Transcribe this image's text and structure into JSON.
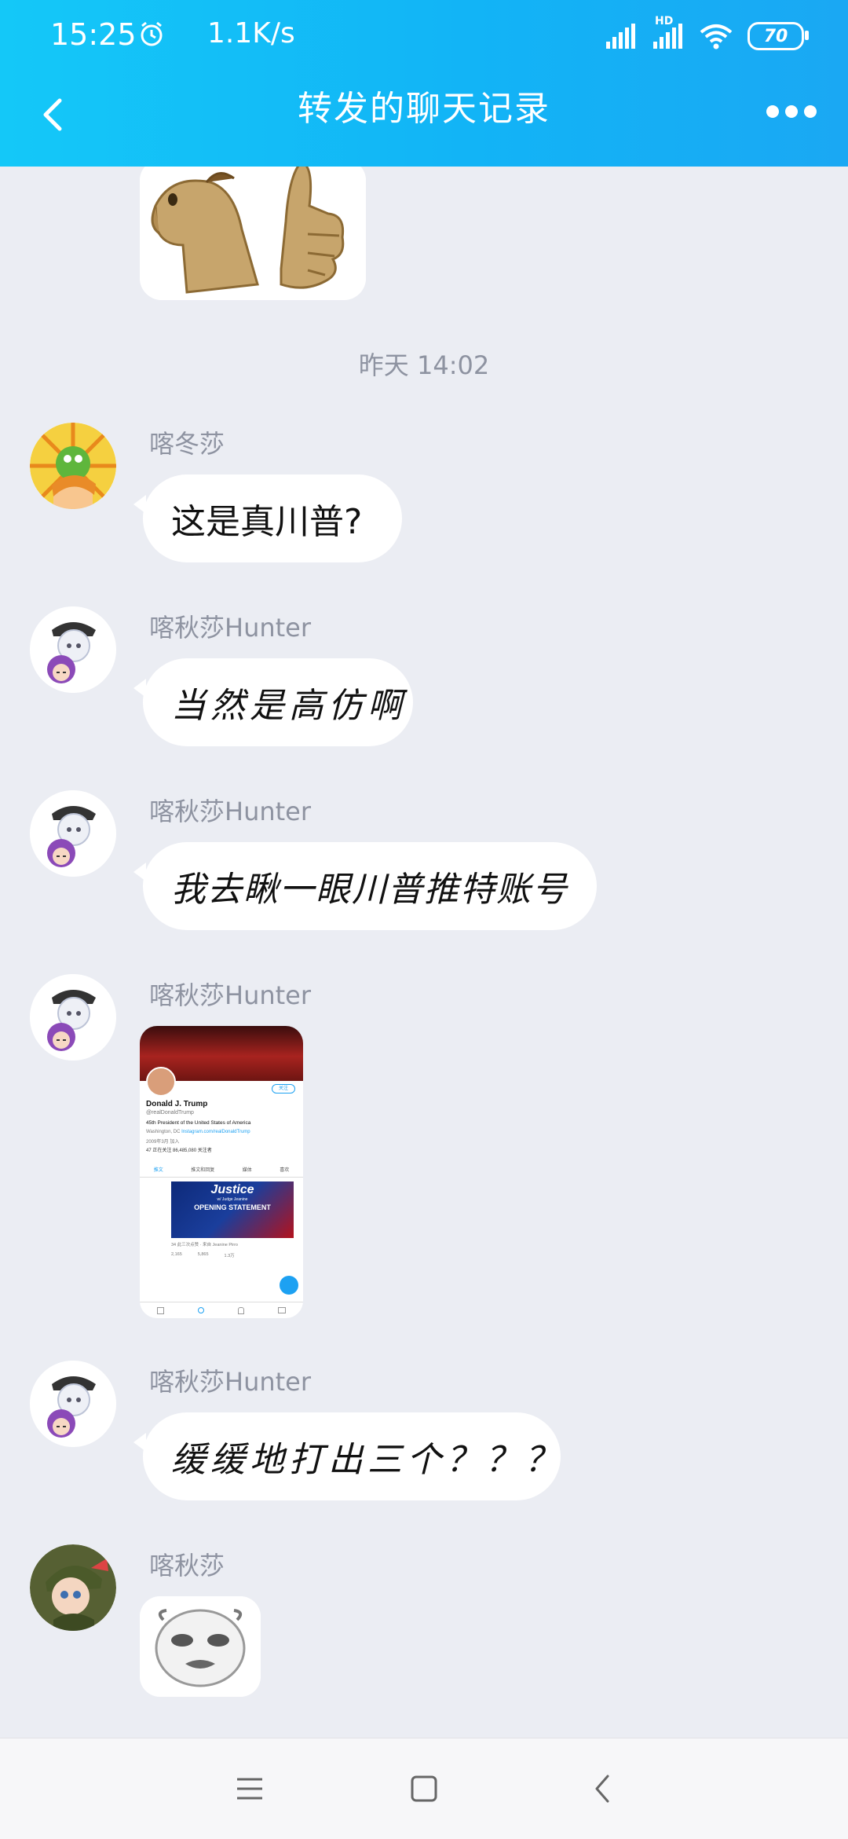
{
  "status_bar": {
    "time": "15:25",
    "speed": "1.1K/s",
    "network_label": "HD",
    "battery": "70"
  },
  "header": {
    "title": "转发的聊天记录"
  },
  "chat": {
    "divider_time": "昨天 14:02",
    "messages": [
      {
        "sender": "喀冬莎",
        "text": "这是真川普?"
      },
      {
        "sender": "喀秋莎Hunter",
        "text": "当然是高仿啊"
      },
      {
        "sender": "喀秋莎Hunter",
        "text": "我去瞅一眼川普推特账号"
      },
      {
        "sender": "喀秋莎Hunter",
        "type": "image"
      },
      {
        "sender": "喀秋莎Hunter",
        "text": "缓缓地打出三个？？？"
      },
      {
        "sender": "喀秋莎",
        "type": "image"
      }
    ]
  },
  "tweet_screenshot": {
    "name": "Donald J. Trump",
    "handle": "@realDonaldTrump",
    "bio": "45th President of the United States of America",
    "location": "Washington, DC",
    "link": "Instagram.com/realDonaldTrump",
    "joined": "2009年3月 加入",
    "follows": "47 正在关注",
    "followers": "86,485,080 关注者",
    "follow_button": "关注",
    "tabs": [
      "推文",
      "推文和回复",
      "媒体",
      "喜欢"
    ],
    "card_title": "Justice",
    "card_subtitle": "w/ Judge Jeanine",
    "card_headline": "OPENING STATEMENT",
    "tweet_meta": "34 此三次点赞 · 来自 Jeanine Pirro",
    "stats": [
      "2,165",
      "5,865",
      "1.3万"
    ]
  }
}
